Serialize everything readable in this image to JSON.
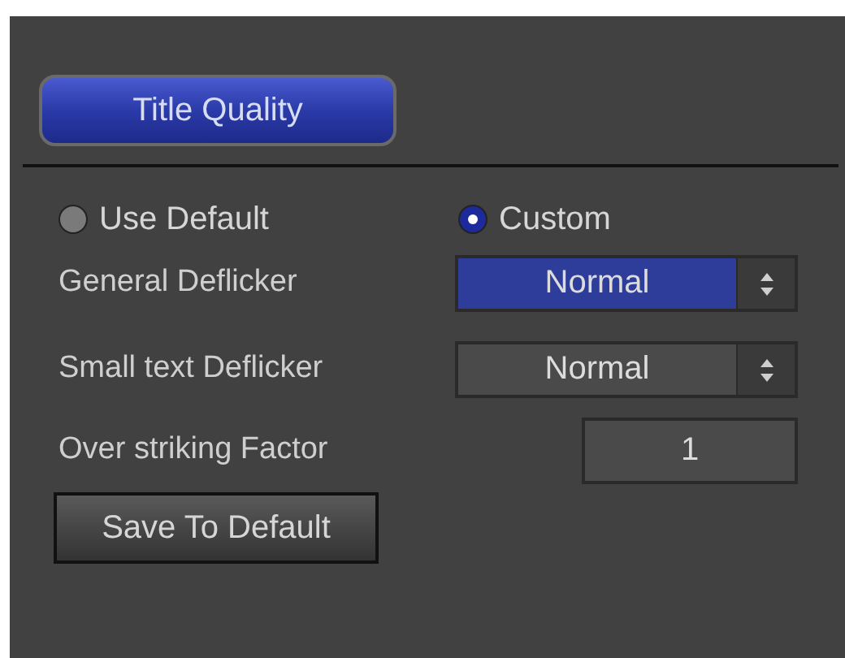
{
  "title_button": {
    "label": "Title Quality"
  },
  "mode": [
    {
      "label": "Use Default",
      "selected": false
    },
    {
      "label": "Custom",
      "selected": true
    }
  ],
  "settings": [
    {
      "kind": "select",
      "label": "General Deflicker",
      "value": "Normal",
      "focused": true
    },
    {
      "kind": "select",
      "label": "Small text Deflicker",
      "value": "Normal",
      "focused": false
    },
    {
      "kind": "number",
      "label": "Over striking Factor",
      "value": "1"
    }
  ],
  "save_button": {
    "label": "Save To Default"
  }
}
